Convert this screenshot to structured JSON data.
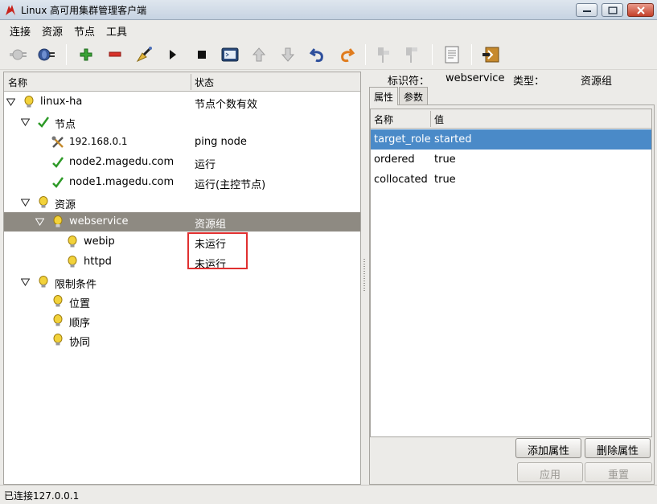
{
  "window": {
    "title": "Linux 高可用集群管理客户端"
  },
  "menu": [
    "连接",
    "资源",
    "节点",
    "工具"
  ],
  "toolbar": [
    "connect-icon",
    "disconnect-icon",
    "add-icon",
    "remove-icon",
    "cleanup-icon",
    "start-icon",
    "stop-icon",
    "console-icon",
    "move-up-icon",
    "move-down-icon",
    "undo-icon",
    "redo-icon",
    "standby-icon",
    "active-icon",
    "log-icon",
    "exit-icon"
  ],
  "tree": {
    "columns": {
      "name": "名称",
      "status": "状态"
    },
    "rows": [
      {
        "label": "linux-ha",
        "status": "节点个数有效"
      },
      {
        "label": "节点",
        "status": ""
      },
      {
        "label": "192.168.0.1",
        "status": "ping node"
      },
      {
        "label": "node2.magedu.com",
        "status": "运行"
      },
      {
        "label": "node1.magedu.com",
        "status": "运行(主控节点)"
      },
      {
        "label": "资源",
        "status": ""
      },
      {
        "label": "webservice",
        "status": "资源组"
      },
      {
        "label": "webip",
        "status": "未运行"
      },
      {
        "label": "httpd",
        "status": "未运行"
      },
      {
        "label": "限制条件",
        "status": ""
      },
      {
        "label": "位置",
        "status": ""
      },
      {
        "label": "顺序",
        "status": ""
      },
      {
        "label": "协同",
        "status": ""
      }
    ]
  },
  "detail": {
    "id_label": "标识符：",
    "id_value": "webservice",
    "type_label": "类型：",
    "type_value": "资源组",
    "tabs": [
      "属性",
      "参数"
    ],
    "columns": {
      "name": "名称",
      "value": "值"
    },
    "rows": [
      {
        "name": "target_role",
        "value": "started"
      },
      {
        "name": "ordered",
        "value": "true"
      },
      {
        "name": "collocated",
        "value": "true"
      }
    ],
    "add_button": "添加属性",
    "delete_button": "删除属性",
    "apply_button": "应用",
    "reset_button": "重置"
  },
  "status_bar": "已连接127.0.0.1",
  "colors": {
    "selection_tree": "#8e8a82",
    "selection_table": "#4a8ac8",
    "highlight": "#e03030"
  }
}
